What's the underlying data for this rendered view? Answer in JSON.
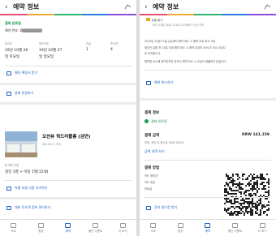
{
  "header": {
    "title": "예약 정보"
  },
  "stripe_colors": [
    "#e94e77",
    "#f3a93a",
    "#2cb56b",
    "#2f7be0",
    "#8a4fd8"
  ],
  "left": {
    "status": "결제 완료됨",
    "booking_no_label": "예약 번호: 8▒▒▒▒▒▒▒▒",
    "checkin": {
      "label": "체크인",
      "date": "19년 10월 26",
      "time": "일 토요일"
    },
    "checkout": {
      "label": "체크아웃",
      "date": "19년 10월 27",
      "time": "일 일요일"
    },
    "rooms": {
      "label": "객실",
      "value": "1"
    },
    "guests": {
      "label": "투숙객",
      "value": "4"
    },
    "confirm_link": "예약 확정서 받기",
    "change_dates": "날짜 변경하기",
    "hotel_name": "오션뷰 쿼드러플룸 (금연)",
    "hotel_amenity": "무료 Wi-Fi, 조식",
    "guest_label": "총 예약 인원",
    "guest_detail": "성인 3명 + 아동 1명(12세)",
    "special_request": "특별 요청 사항 추가하기",
    "guest_manage": "대표 투숙객 정보 관리하기"
  },
  "right": {
    "cancel_title": "환불 불가",
    "cancel_sub": "19년 10월 26일 12:00 (자이베이 시간) 이후",
    "cancel_body_1": "2019년 10월 11일 (금)까지 예약 취소 시 예약 무료 취소 가능.",
    "cancel_body_2": "체크인 날짜 전 14일 이내 예약 취소 시 예약 요금의 50%가 취소 요금으",
    "cancel_body_3": "로 부과됩니다.",
    "cancel_body_4": "예약한 숙소에 체크인하지 않거나 예약 취소 시 요금이 환불되지 않습니다.",
    "cancel_link": "예약 취소하기",
    "payment_title": "결제 정보",
    "payment_status": "결제 완료됨",
    "amount_label": "결제 금액",
    "amount_value": "KRW 141,159",
    "tax_label": "포함: 세금 및 봉사료 KRW 20692",
    "detail_link": "금액 내역 보기",
    "method_title": "결제 방법",
    "card_holder": "카드 명의자",
    "card_number": "카드 번호",
    "card_expiry": "만료일",
    "receipt_link": "전자 영수증 받기"
  },
  "tabs": [
    {
      "label": "숙소"
    },
    {
      "label": "항공"
    },
    {
      "label": "예약"
    },
    {
      "label": "할인 이벤트"
    },
    {
      "label": "더 보기"
    }
  ]
}
